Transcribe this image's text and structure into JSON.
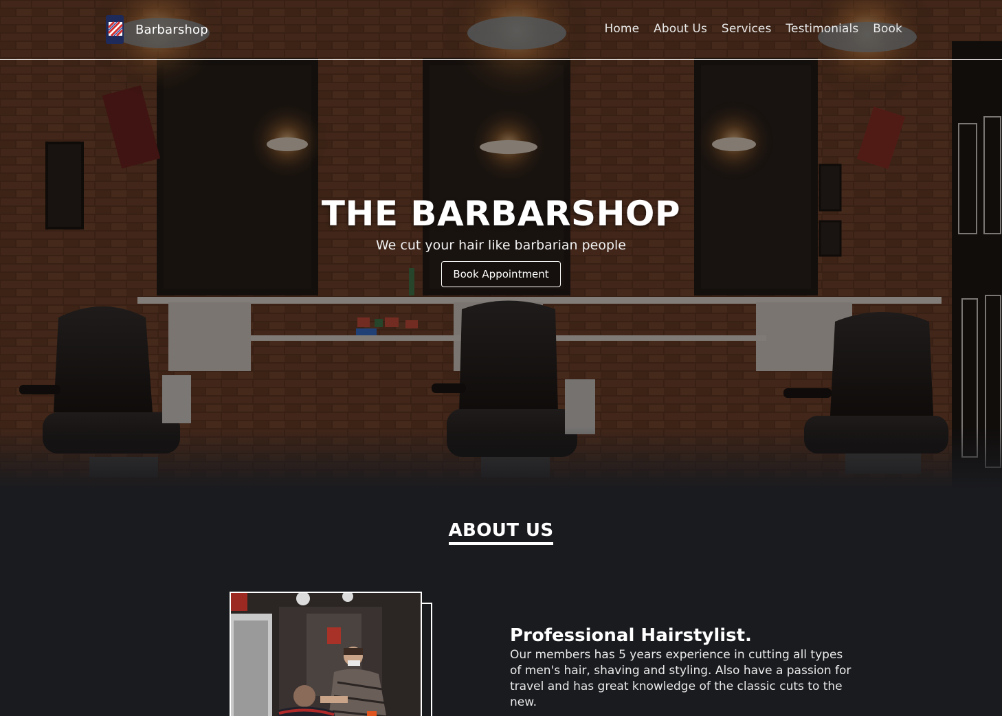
{
  "brand": {
    "name": "Barbarshop",
    "icon": "barber-pole-icon"
  },
  "nav": {
    "items": [
      {
        "label": "Home"
      },
      {
        "label": "About Us"
      },
      {
        "label": "Services"
      },
      {
        "label": "Testimonials"
      },
      {
        "label": "Book"
      }
    ]
  },
  "hero": {
    "title": "THE BARBARSHOP",
    "subtitle": "We cut your hair like barbarian people",
    "button_label": "Book Appointment"
  },
  "about": {
    "heading": "ABOUT US",
    "title": "Professional Hairstylist.",
    "body": "Our members has 5 years experience in cutting all types of men's hair, shaving and styling. Also have a passion for travel and has great knowledge of the classic cuts to the new."
  },
  "colors": {
    "background": "#1a1b1f",
    "text": "#ffffff",
    "hero_overlay": "#120c08"
  }
}
